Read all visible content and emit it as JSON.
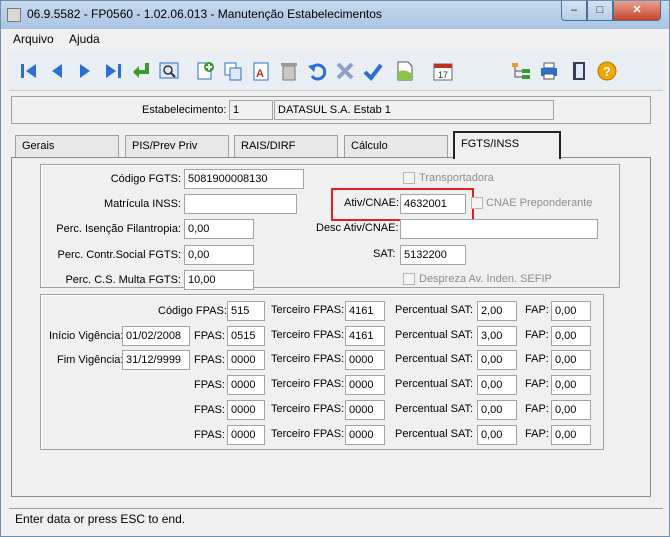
{
  "window": {
    "title": "06.9.5582 - FP0560 - 1.02.06.013 - Manutenção Estabelecimentos",
    "minimize_glyph": "–",
    "maximize_glyph": "□",
    "close_glyph": "✕"
  },
  "menu": [
    "Arquivo",
    "Ajuda"
  ],
  "toolbar_icons": [
    "first-icon",
    "previous-icon",
    "next-icon",
    "last-icon",
    "goto-icon",
    "search-icon",
    "add-icon",
    "copy-icon",
    "edit-icon",
    "delete-icon",
    "undo-icon",
    "cancel-icon",
    "save-icon",
    "new-document-icon",
    "calendar-icon",
    "hierarchy-icon",
    "print-icon",
    "exit-icon",
    "help-icon"
  ],
  "header": {
    "label": "Estabelecimento:",
    "code": "1",
    "name": "DATASUL S.A. Estab 1"
  },
  "tabs": [
    "Gerais",
    "PIS/Prev Priv",
    "RAIS/DIRF",
    "Cálculo",
    "FGTS/INSS"
  ],
  "fgts": {
    "codigo_fgts_label": "Código FGTS:",
    "codigo_fgts": "5081900008130",
    "transportadora_label": "Transportadora",
    "matricula_inss_label": "Matrícula INSS:",
    "matricula_inss": "",
    "ativ_cnae_label": "Ativ/CNAE:",
    "ativ_cnae": "4632001",
    "cnae_preponderante_label": "CNAE Preponderante",
    "perc_isencao_label": "Perc. Isenção Filantropia:",
    "perc_isencao": "0,00",
    "desc_ativ_cnae_label": "Desc Ativ/CNAE:",
    "desc_ativ_cnae": "",
    "perc_contr_social_label": "Perc. Contr.Social FGTS:",
    "perc_contr_social": "0,00",
    "sat_label": "SAT:",
    "sat": "5132200",
    "perc_cs_multa_label": "Perc. C.S. Multa FGTS:",
    "perc_cs_multa": "10,00",
    "despreza_label": "Despreza Av. Inden. SEFIP"
  },
  "fpas": {
    "codigo_fpas_label": "Código FPAS:",
    "codigo_fpas": "515",
    "inicio_vigencia_label": "Início Vigência:",
    "inicio_vigencia": "01/02/2008",
    "fim_vigencia_label": "Fim Vigência:",
    "fim_vigencia": "31/12/9999",
    "fpas_label": "FPAS:",
    "terceiro_label": "Terceiro FPAS:",
    "percentual_label": "Percentual SAT:",
    "fap_label": "FAP:",
    "rows": [
      {
        "fpas": "",
        "terceiro": "4161",
        "percentual": "2,00",
        "fap": "0,00"
      },
      {
        "fpas": "0515",
        "terceiro": "4161",
        "percentual": "3,00",
        "fap": "0,00"
      },
      {
        "fpas": "0000",
        "terceiro": "0000",
        "percentual": "0,00",
        "fap": "0,00"
      },
      {
        "fpas": "0000",
        "terceiro": "0000",
        "percentual": "0,00",
        "fap": "0,00"
      },
      {
        "fpas": "0000",
        "terceiro": "0000",
        "percentual": "0,00",
        "fap": "0,00"
      },
      {
        "fpas": "0000",
        "terceiro": "0000",
        "percentual": "0,00",
        "fap": "0,00"
      }
    ]
  },
  "status": "Enter data or press ESC to end.",
  "colors": {
    "highlight": "#e02020",
    "accent_blue": "#2a6fd1"
  }
}
